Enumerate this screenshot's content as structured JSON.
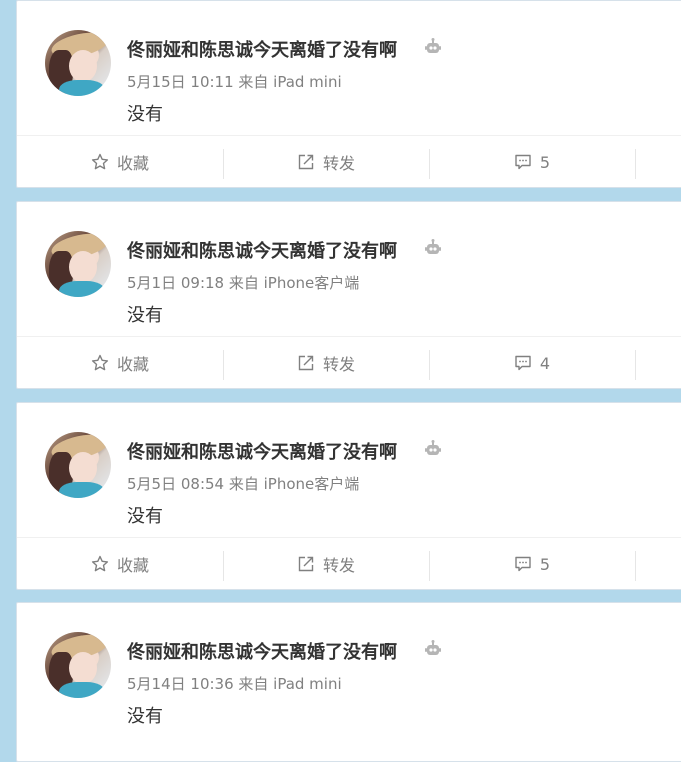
{
  "posts": [
    {
      "author": "佟丽娅和陈思诚今天离婚了没有啊",
      "meta": "5月15日 10:11 来自 iPad mini",
      "text": "没有",
      "favorite_label": "收藏",
      "repost_label": "转发",
      "comment_count": "5"
    },
    {
      "author": "佟丽娅和陈思诚今天离婚了没有啊",
      "meta": "5月1日 09:18 来自 iPhone客户端",
      "text": "没有",
      "favorite_label": "收藏",
      "repost_label": "转发",
      "comment_count": "4"
    },
    {
      "author": "佟丽娅和陈思诚今天离婚了没有啊",
      "meta": "5月5日 08:54 来自 iPhone客户端",
      "text": "没有",
      "favorite_label": "收藏",
      "repost_label": "转发",
      "comment_count": "5"
    },
    {
      "author": "佟丽娅和陈思诚今天离婚了没有啊",
      "meta": "5月14日 10:36 来自 iPad mini",
      "text": "没有"
    }
  ],
  "colors": {
    "page_background": "#b2d8eb",
    "card_background": "#ffffff",
    "name_text": "#333333",
    "meta_text": "#808080"
  },
  "icons": {
    "avatar": "avatar-photo",
    "author_badge": "robot-icon",
    "favorite": "star-icon",
    "repost": "share-box-icon",
    "comment": "comment-bubble-icon"
  }
}
